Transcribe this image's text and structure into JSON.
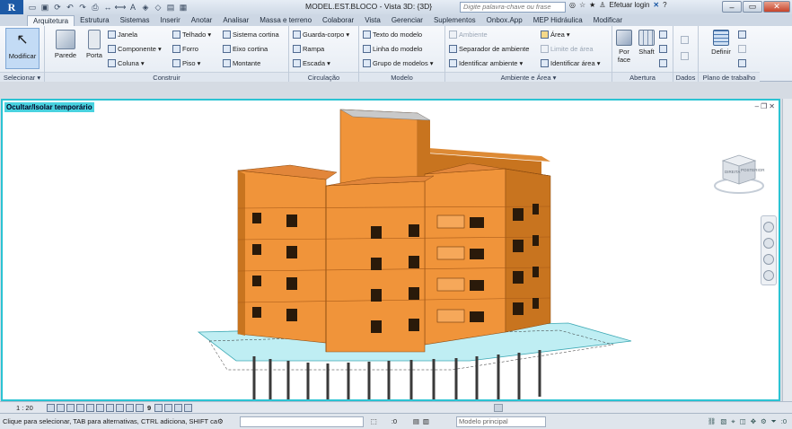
{
  "app": {
    "logo_letter": "R",
    "document_title": "MODEL.EST.BLOCO - Vista 3D: {3D}",
    "search_placeholder": "Digite palavra-chave ou frase",
    "login_label": "Efetuar login",
    "help_label": "?"
  },
  "tabs": [
    "Arquitetura",
    "Estrutura",
    "Sistemas",
    "Inserir",
    "Anotar",
    "Analisar",
    "Massa e terreno",
    "Colaborar",
    "Vista",
    "Gerenciar",
    "Suplementos",
    "Onbox.App",
    "MEP Hidráulica",
    "Modificar"
  ],
  "ribbon": {
    "selecionar": {
      "modify_label": "Modificar",
      "panel_label": "Selecionar ▾"
    },
    "construir": {
      "panel_label": "Construir",
      "parede": "Parede",
      "porta": "Porta",
      "janela": "Janela",
      "componente": "Componente ▾",
      "coluna": "Coluna ▾",
      "telhado": "Telhado ▾",
      "forro": "Forro",
      "piso": "Piso ▾",
      "sistema_cortina": "Sistema cortina",
      "eixo_cortina": "Eixo cortina",
      "montante": "Montante"
    },
    "circulacao": {
      "panel_label": "Circulação",
      "guarda_corpo": "Guarda-corpo ▾",
      "rampa": "Rampa",
      "escada": "Escada ▾"
    },
    "modelo": {
      "panel_label": "Modelo",
      "texto": "Texto do modelo",
      "linha": "Linha do modelo",
      "grupo": "Grupo de modelos ▾"
    },
    "ambiente": {
      "panel_label": "Ambiente e Área ▾",
      "ambiente": "Ambiente",
      "separador": "Separador de ambiente",
      "identificar_ambiente": "Identificar ambiente ▾",
      "area": "Área ▾",
      "limite": "Limite de área",
      "identificar_area": "Identificar área ▾"
    },
    "abertura": {
      "panel_label": "Abertura",
      "por_face": "Por face",
      "shaft": "Shaft"
    },
    "dados": {
      "panel_label": "Dados"
    },
    "plano": {
      "panel_label": "Plano de trabalho",
      "definir": "Definir"
    }
  },
  "viewport": {
    "flag": "Ocultar/Isolar temporário",
    "viewcube_labels": [
      "DIREITA",
      "POSTERIOR"
    ],
    "colors": {
      "border": "#2bc3d3",
      "facade": "#f0943a",
      "facade_shadow": "#c8741f",
      "roof": "#c9c9c9"
    }
  },
  "view_control": {
    "scale": "1 : 20",
    "hidden_count": "9"
  },
  "status": {
    "hint": "Clique para selecionar, TAB para alternativas, CTRL adiciona, SHIFT ca",
    "selected_count": ":0",
    "model": "Modelo principal",
    "filter_count": ":0"
  }
}
